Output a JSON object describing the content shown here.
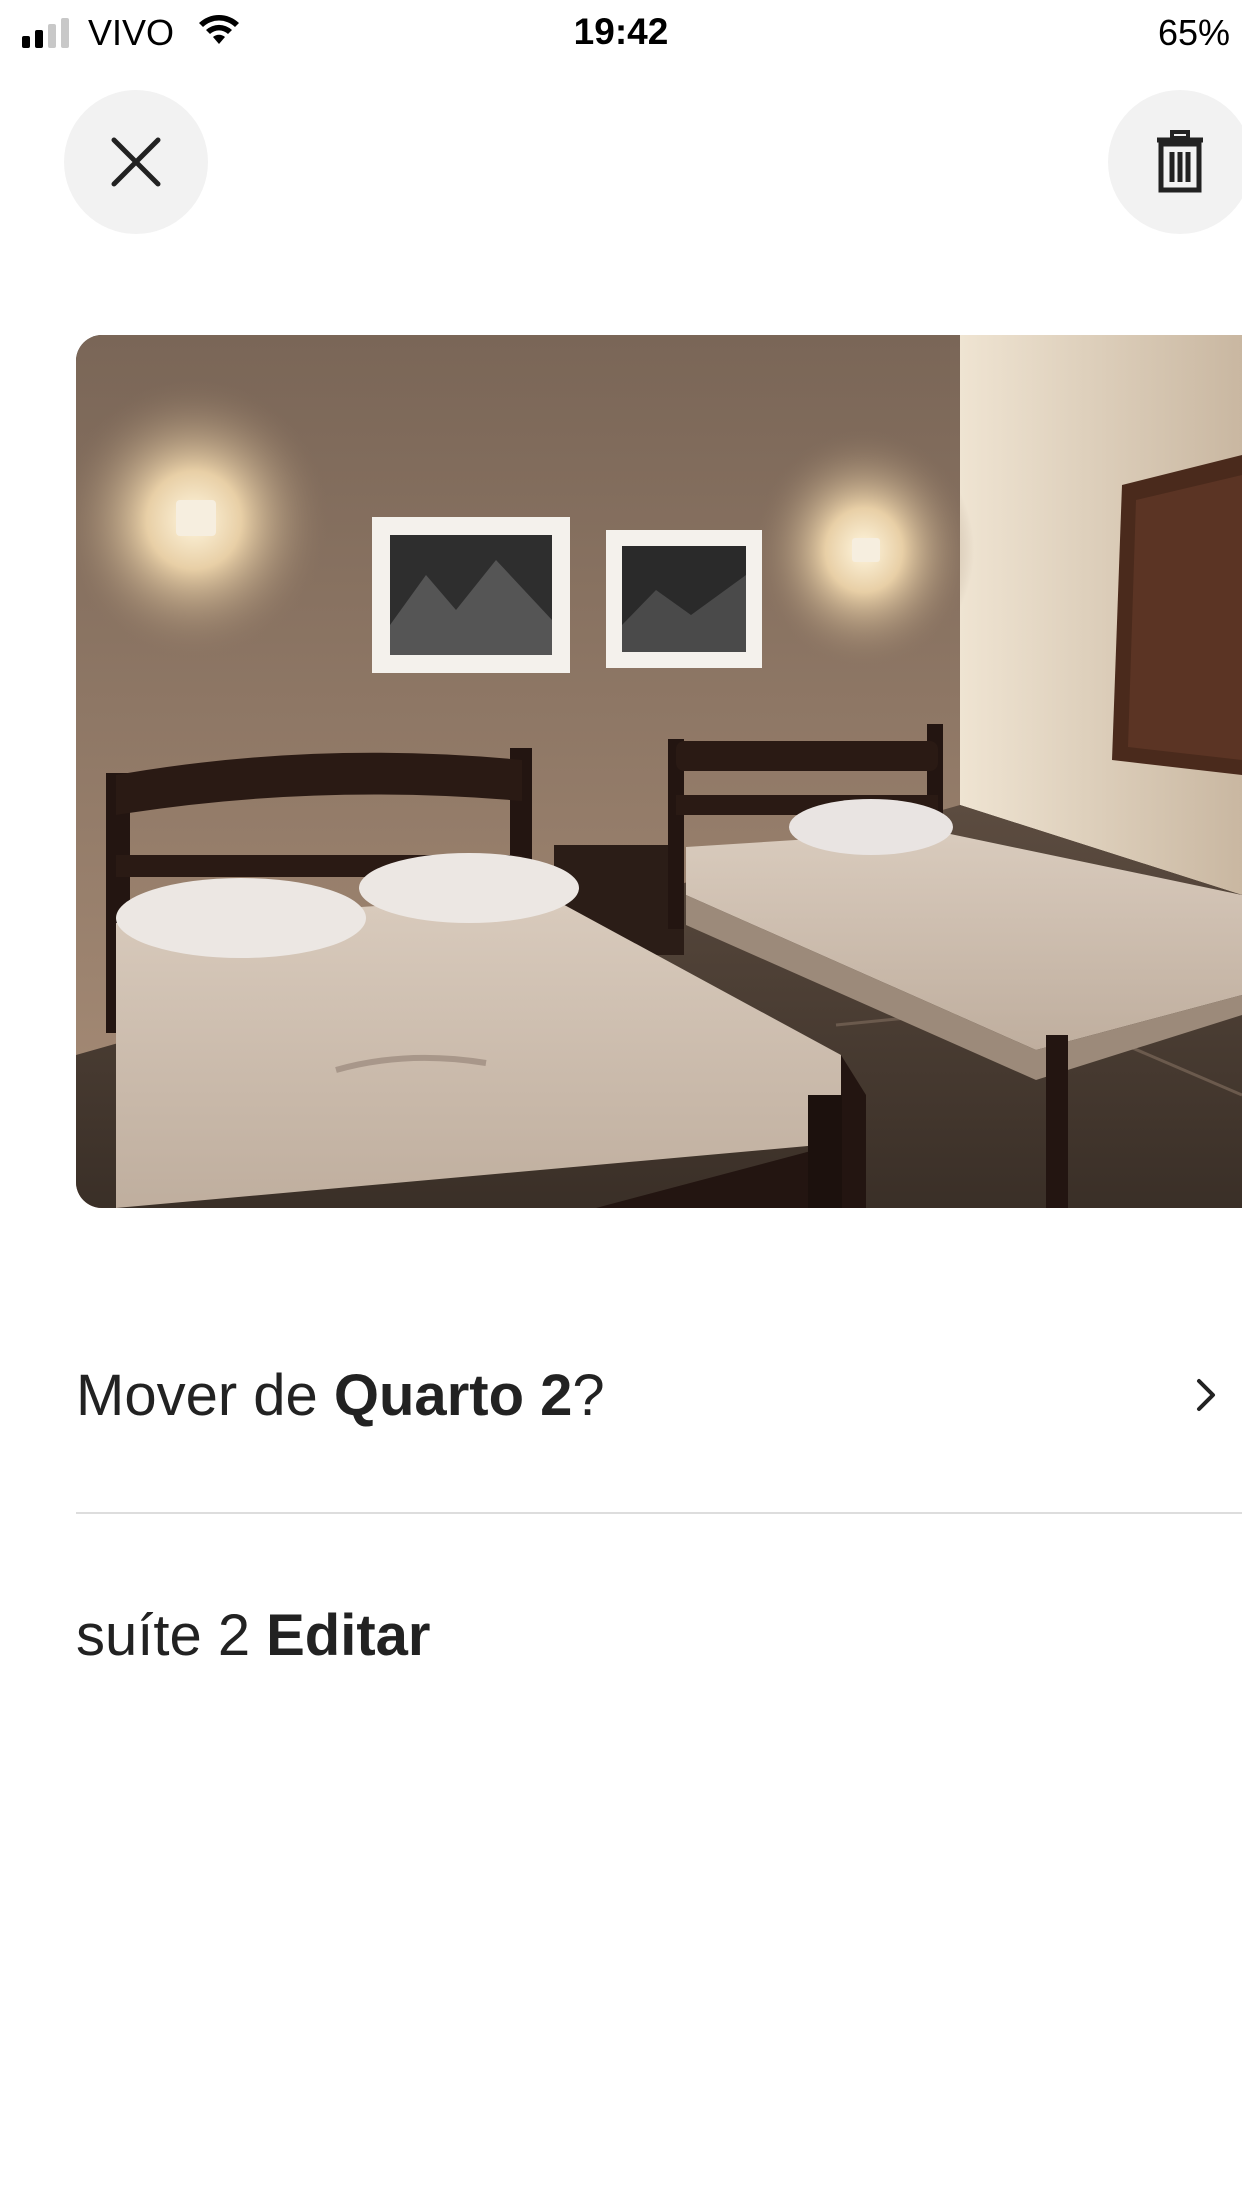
{
  "status_bar": {
    "carrier": "VIVO",
    "time": "19:42",
    "battery": "65%"
  },
  "icons": {
    "close": "close-icon",
    "delete": "trash-icon",
    "chevron": "chevron-right-icon"
  },
  "photo": {
    "description_icon": "room-photo"
  },
  "move": {
    "prefix": "Mover de ",
    "room": "Quarto 2",
    "suffix": "?"
  },
  "caption": {
    "text": "suíte 2",
    "edit_label": "Editar"
  },
  "colors": {
    "text": "#222222",
    "button_bg": "#f2f2f2",
    "divider": "#dddddd"
  }
}
